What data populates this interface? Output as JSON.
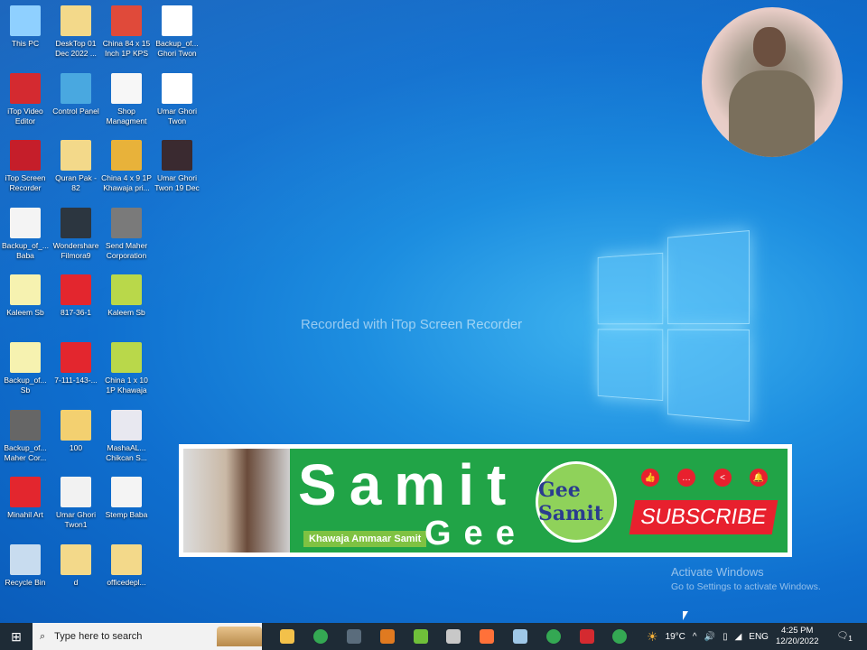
{
  "desktop": {
    "icons": [
      {
        "label": "This PC",
        "color": "#8fd0ff"
      },
      {
        "label": "DeskTop 01 Dec 2022 ...",
        "color": "#f3d98a"
      },
      {
        "label": "China 84 x 15 Inch 1P KPS",
        "color": "#e04a3a"
      },
      {
        "label": "Backup_of... Ghori Twon",
        "color": "#ffffff"
      },
      {
        "label": "iTop Video Editor",
        "color": "#d42a30"
      },
      {
        "label": "Control Panel",
        "color": "#49a8e0"
      },
      {
        "label": "Shop Managment",
        "color": "#f7f7f7"
      },
      {
        "label": "Umar Ghori Twon",
        "color": "#ffffff"
      },
      {
        "label": "iTop Screen Recorder",
        "color": "#c51e2a"
      },
      {
        "label": "Quran Pak - 82",
        "color": "#f3d98a"
      },
      {
        "label": "China 4 x 9 1P Khawaja pri...",
        "color": "#e8b23a"
      },
      {
        "label": "Umar Ghori Twon 19 Dec",
        "color": "#3a2a30"
      },
      {
        "label": "Backup_of_... Baba",
        "color": "#f4f4f4"
      },
      {
        "label": "Wondershare Filmora9",
        "color": "#2c3640"
      },
      {
        "label": "Send Maher Corporation",
        "color": "#7a7a7a"
      },
      {
        "label": "Kaleem Sb",
        "color": "#f6f2b0"
      },
      {
        "label": "817-36-1",
        "color": "#e3262e"
      },
      {
        "label": "Kaleem Sb",
        "color": "#b9d84a"
      },
      {
        "label": "Backup_of... Sb",
        "color": "#f6f2b0"
      },
      {
        "label": "7-111-143-...",
        "color": "#e3262e"
      },
      {
        "label": "China 1 x 10 1P Khawaja",
        "color": "#b9d84a"
      },
      {
        "label": "Backup_of... Maher Cor...",
        "color": "#666666"
      },
      {
        "label": "100",
        "color": "#f3d070"
      },
      {
        "label": "MashaAL... Chikcan S...",
        "color": "#e8e8f0"
      },
      {
        "label": "Minahil Art",
        "color": "#e3262e"
      },
      {
        "label": "Umar Ghori Twon1",
        "color": "#f2f2f2"
      },
      {
        "label": "Stemp Baba",
        "color": "#f4f4f4"
      },
      {
        "label": "Recycle Bin",
        "color": "#c8dcef"
      },
      {
        "label": "d",
        "color": "#f3d98a"
      },
      {
        "label": "officedepl...",
        "color": "#f3d98a"
      }
    ]
  },
  "watermark": "Recorded with iTop Screen Recorder",
  "banner": {
    "title": "Samit",
    "subtitle": "Gee",
    "tagline": "Khawaja Ammaar Samit",
    "logo": "Gee Samit",
    "subscribe": "SUBSCRIBE",
    "social_icons": [
      "like-icon",
      "comment-icon",
      "share-icon",
      "bell-icon"
    ]
  },
  "activation": {
    "title": "Activate Windows",
    "subtitle": "Go to Settings to activate Windows."
  },
  "taskbar": {
    "search_placeholder": "Type here to search",
    "apps": [
      {
        "name": "file-explorer",
        "color": "#f3c14a"
      },
      {
        "name": "chrome",
        "color": "#34a853"
      },
      {
        "name": "calculator",
        "color": "#5a6c7c"
      },
      {
        "name": "photo-app",
        "color": "#e07a20"
      },
      {
        "name": "corel",
        "color": "#6fbf3a"
      },
      {
        "name": "calendar-app",
        "color": "#c8c8c8"
      },
      {
        "name": "firefox",
        "color": "#ff7139"
      },
      {
        "name": "notes-app",
        "color": "#9fc8e8"
      },
      {
        "name": "chrome-2",
        "color": "#34a853"
      },
      {
        "name": "itop-recorder",
        "color": "#d42a30"
      },
      {
        "name": "chrome-3",
        "color": "#34a853"
      }
    ],
    "weather": "19°C",
    "language": "ENG",
    "time": "4:25 PM",
    "date": "12/20/2022",
    "notifications": "1"
  }
}
